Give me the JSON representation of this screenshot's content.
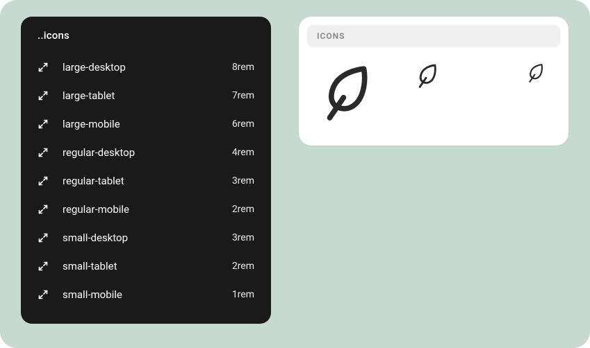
{
  "tokens_panel": {
    "title": "..icons",
    "rows": [
      {
        "name": "large-desktop",
        "value": "8rem"
      },
      {
        "name": "large-tablet",
        "value": "7rem"
      },
      {
        "name": "large-mobile",
        "value": "6rem"
      },
      {
        "name": "regular-desktop",
        "value": "4rem"
      },
      {
        "name": "regular-tablet",
        "value": "3rem"
      },
      {
        "name": "regular-mobile",
        "value": "2rem"
      },
      {
        "name": "small-desktop",
        "value": "3rem"
      },
      {
        "name": "small-tablet",
        "value": "2rem"
      },
      {
        "name": "small-mobile",
        "value": "1rem"
      }
    ]
  },
  "preview": {
    "header_label": "ICONS"
  }
}
